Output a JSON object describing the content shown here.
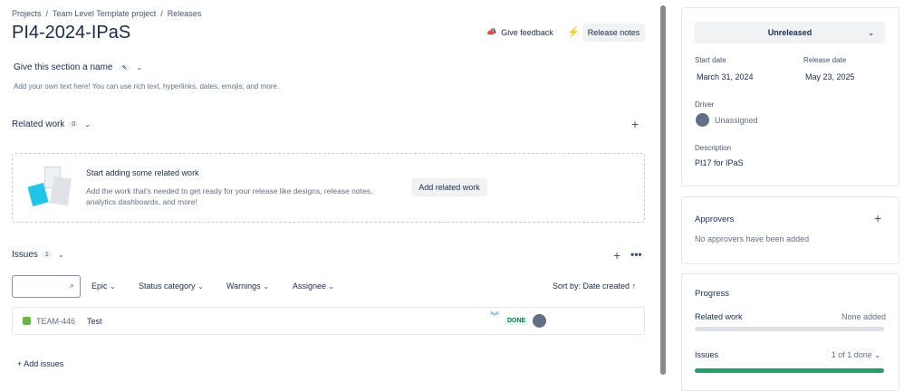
{
  "breadcrumb": [
    "Projects",
    "Team Level Template project",
    "Releases"
  ],
  "title": "PI4-2024-IPaS",
  "header": {
    "feedback": "Give feedback",
    "release_notes": "Release notes"
  },
  "section": {
    "name": "Give this section a name",
    "text": "Add your own text here! You can use rich text, hyperlinks, dates, emojis, and more."
  },
  "related": {
    "title": "Related work",
    "count": "0",
    "empty_title": "Start adding some related work",
    "empty_text_1": "Add the work that's needed to get ready for your release like designs, release notes,",
    "empty_text_2": "analytics dashboards, and more!",
    "add_button": "Add related work"
  },
  "issues": {
    "title": "Issues",
    "count": "1",
    "filters": [
      "Epic",
      "Status category",
      "Warnings",
      "Assignee"
    ],
    "sort": "Sort by: Date created",
    "rows": [
      {
        "key": "TEAM-446",
        "summary": "Test",
        "status": "DONE"
      }
    ],
    "add": "Add issues"
  },
  "panel": {
    "status": "Unreleased",
    "start_label": "Start date",
    "start": "March 31, 2024",
    "release_label": "Release date",
    "release": "May 23, 2025",
    "driver_label": "Driver",
    "driver": "Unassigned",
    "desc_label": "Description",
    "desc": "PI17 for IPaS"
  },
  "approvers": {
    "title": "Approvers",
    "empty": "No approvers have been added"
  },
  "progress": {
    "title": "Progress",
    "related_label": "Related work",
    "related_value": "None added",
    "related_fraction": 0,
    "issues_label": "Issues",
    "issues_value": "1 of 1 done",
    "issues_fraction": 1
  },
  "colors": {
    "done_green": "#22a06b",
    "story_green": "#63ba3c",
    "priority_blue": "#1d7afc"
  }
}
